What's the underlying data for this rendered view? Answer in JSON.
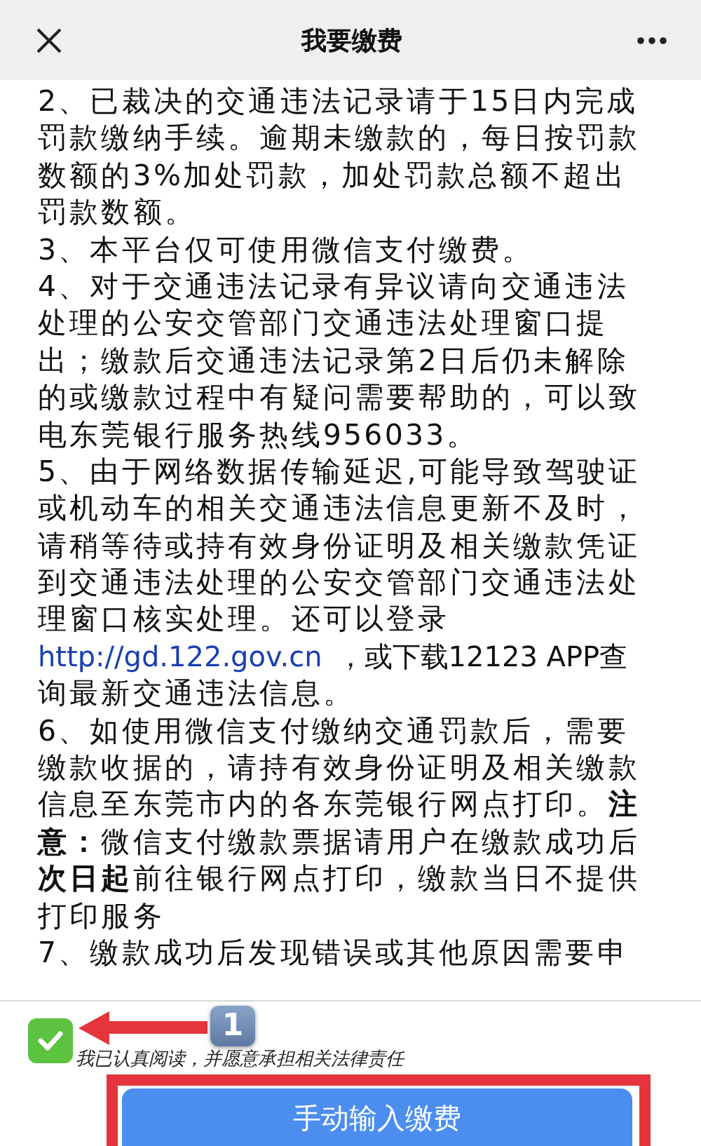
{
  "header": {
    "title": "我要缴费"
  },
  "notice": [
    {
      "kind": "text",
      "lines": [
        "2、已裁决的交通违法记录请于15日内完成",
        "罚款缴纳手续。逾期未缴款的，每日按罚款",
        "数额的3%加处罚款，加处罚款总额不超出",
        "罚款数额。"
      ]
    },
    {
      "kind": "text",
      "lines": [
        "3、本平台仅可使用微信支付缴费。"
      ]
    },
    {
      "kind": "text",
      "lines": [
        "4、对于交通违法记录有异议请向交通违法",
        "处理的公安交管部门交通违法处理窗口提",
        "出；缴款后交通违法记录第2日后仍未解除",
        "的或缴款过程中有疑问需要帮助的，可以致",
        "电东莞银行服务热线956033。"
      ]
    },
    {
      "kind": "text",
      "lines": [
        "5、由于网络数据传输延迟,可能导致驾驶证",
        "或机动车的相关交通违法信息更新不及时，",
        "请稍等待或持有效身份证明及相关缴款凭证",
        "到交通违法处理的公安交管部门交通违法处",
        "理窗口核实处理。还可以登录"
      ]
    },
    {
      "kind": "link",
      "link": "http://gd.122.gov.cn",
      "after": "，或下载12123 APP查"
    },
    {
      "kind": "text",
      "lines": [
        "询最新交通违法信息。"
      ]
    },
    {
      "kind": "text",
      "lines": [
        "6、如使用微信支付缴纳交通罚款后，需要",
        "缴款收据的，请持有效身份证明及相关缴款",
        "信息至东莞市内的各东莞银行网点打印。**注**",
        "**意：**微信支付缴款票据请用户在缴款成功后",
        "**次日起**前往银行网点打印，缴款当日不提供",
        "打印服务"
      ]
    },
    {
      "kind": "text",
      "lines": [
        "7、缴款成功后发现错误或其他原因需要申"
      ]
    }
  ],
  "agreement": {
    "checked": true,
    "label": "我已认真阅读，并愿意承担相关法律责任"
  },
  "button": {
    "label": "手动输入缴费"
  },
  "annotation": {
    "badge": "1"
  }
}
